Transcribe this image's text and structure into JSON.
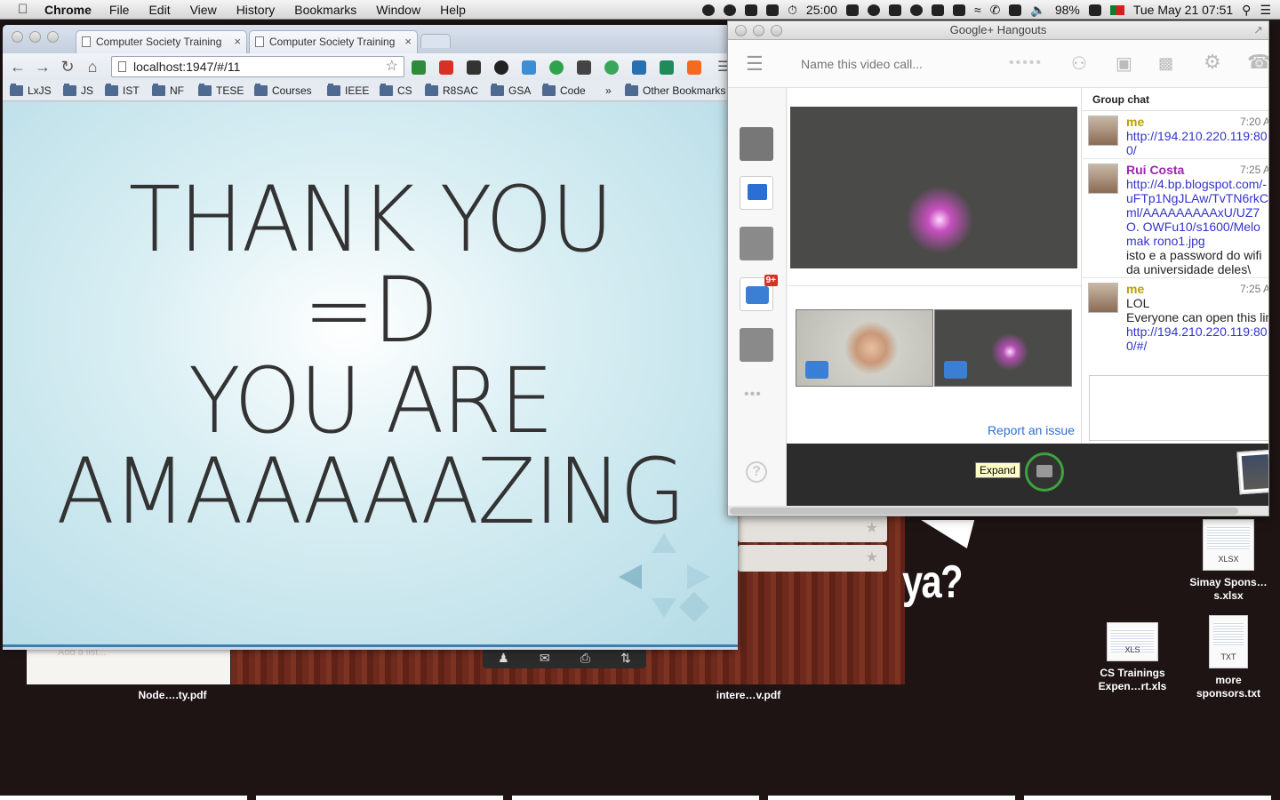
{
  "menubar": {
    "app_name": "Chrome",
    "menus": [
      "File",
      "Edit",
      "View",
      "History",
      "Bookmarks",
      "Window",
      "Help"
    ],
    "timer": "25:00",
    "battery": "98%",
    "datetime": "Tue May 21  07:51"
  },
  "chrome": {
    "tabs": [
      {
        "title": "Computer Society Training"
      },
      {
        "title": "Computer Society Training"
      }
    ],
    "url": "localhost:1947/#/11",
    "bookmarks": [
      "LxJS",
      "JS",
      "IST",
      "NF",
      "TESE",
      "Courses",
      "IEEE",
      "CS",
      "R8SAC",
      "GSA",
      "Code"
    ],
    "bookmarks_overflow": "»",
    "other_bookmarks": "Other Bookmarks",
    "slide": {
      "lines": [
        "THANK YOU",
        "=D",
        "YOU ARE",
        "AMAAAAAZING"
      ]
    }
  },
  "hangouts": {
    "window_title": "Google+ Hangouts",
    "name_placeholder": "Name this video call...",
    "notification_badge": "9+",
    "report_link": "Report an issue",
    "chat_header": "Group chat",
    "expand_tooltip": "Expand",
    "messages": [
      {
        "author": "me",
        "time": "7:20 A",
        "link": "http://194.210.220.119:80 0/",
        "text": ""
      },
      {
        "author": "Rui Costa",
        "time": "7:25 A",
        "link": "http://4.bp.blogspot.com/-uFTp1NgJLAw/TvTN6rkC ml/AAAAAAAAAxU/UZ7O. OWFu10/s1600/Melomak rono1.jpg",
        "text": "isto e a password do wifi da universidade deles\\"
      },
      {
        "author": "me",
        "time": "7:25 A",
        "text": "LOL",
        "text2": "Everyone can open this lin",
        "link": "http://194.210.220.119:80 0/#/",
        "link2": "http://194.210.220.119:80"
      }
    ]
  },
  "desktop": {
    "files": [
      {
        "name": "Simay Spons…s.xlsx",
        "type": "XLSX"
      },
      {
        "name": "CS Trainings Expen…rt.xls",
        "type": "XLS"
      },
      {
        "name": "more sponsors.txt",
        "type": "TXT"
      },
      {
        "name": "Node….ty.pdf",
        "type": "PDF"
      },
      {
        "name": "intere…v.pdf",
        "type": "PDF"
      }
    ],
    "wallpaper_text": "ya?",
    "notes_placeholder": "Add a list..."
  }
}
